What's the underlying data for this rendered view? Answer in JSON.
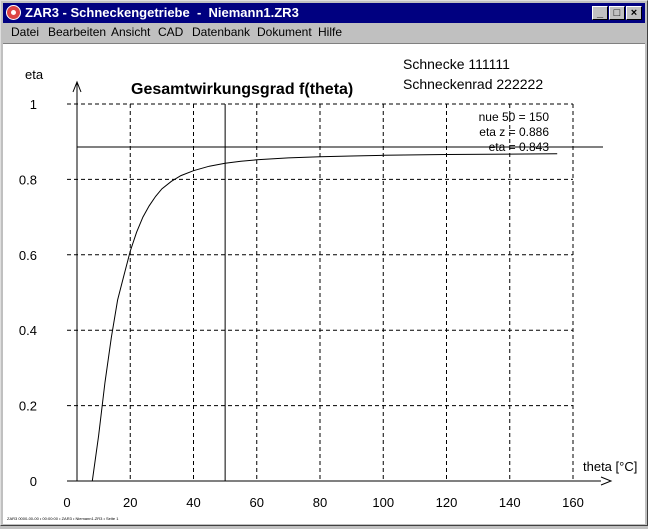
{
  "window": {
    "title": "ZAR3 - Schneckengetriebe  -  Niemann1.ZR3",
    "controls": {
      "minimize": "_",
      "maximize": "□",
      "close": "×"
    }
  },
  "menu": {
    "items": [
      {
        "label": "Datei"
      },
      {
        "label": "Bearbeiten"
      },
      {
        "label": "Ansicht"
      },
      {
        "label": "CAD"
      },
      {
        "label": "Datenbank"
      },
      {
        "label": "Dokument"
      },
      {
        "label": "Hilfe"
      }
    ]
  },
  "plot": {
    "info_lines": [
      "Schnecke 111111",
      "Schneckenrad 222222"
    ],
    "annotations": [
      "nue 50 = 150",
      "eta z = 0.886",
      "eta   = 0.843"
    ],
    "footer": "ZAR3 0000-00-00 • 00:00:00 • ZAR3 • Niemann1.ZR3 • Seite 1"
  },
  "chart_data": {
    "type": "line",
    "title": "Gesamtwirkungsgrad  f(theta)",
    "xlabel": "theta [°C]",
    "ylabel": "eta",
    "xlim": [
      0,
      160
    ],
    "ylim": [
      0,
      1
    ],
    "xticks": [
      0,
      20,
      40,
      60,
      80,
      100,
      120,
      140,
      160
    ],
    "yticks": [
      0,
      0.2,
      0.4,
      0.6,
      0.8,
      1
    ],
    "grid": true,
    "series": [
      {
        "x": [
          8,
          10,
          12,
          14,
          16,
          18,
          20,
          22,
          24,
          26,
          28,
          30,
          33,
          36,
          40,
          45,
          50,
          55,
          60,
          70,
          80,
          90,
          100,
          120,
          140,
          155
        ],
        "y": [
          0,
          0.12,
          0.26,
          0.38,
          0.48,
          0.545,
          0.61,
          0.66,
          0.7,
          0.73,
          0.755,
          0.775,
          0.795,
          0.81,
          0.823,
          0.835,
          0.843,
          0.848,
          0.852,
          0.857,
          0.86,
          0.862,
          0.864,
          0.866,
          0.867,
          0.868
        ]
      }
    ],
    "reference_lines": {
      "x": 50,
      "y": 0.886
    }
  }
}
